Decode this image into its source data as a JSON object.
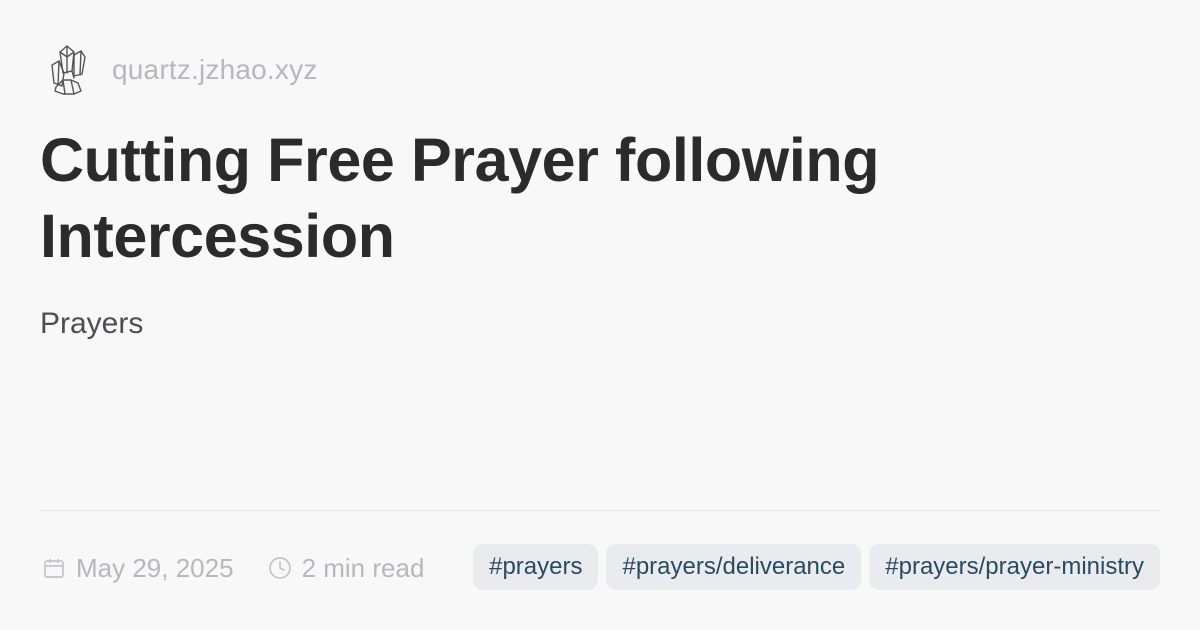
{
  "site": {
    "url": "quartz.jzhao.xyz",
    "logo_icon": "crystal-icon"
  },
  "article": {
    "title": "Cutting Free Prayer following Intercession",
    "description": "Prayers",
    "date": "May 29, 2025",
    "reading_time": "2 min read",
    "tags": [
      "#prayers",
      "#prayers/deliverance",
      "#prayers/prayer-ministry"
    ]
  },
  "icons": {
    "date": "calendar-icon",
    "reading_time": "clock-icon"
  },
  "colors": {
    "background": "#f8f8f9",
    "title": "#2b2b2b",
    "muted_text": "#b8b8bc",
    "tag_background": "#e9ebef",
    "tag_text": "#284b63"
  }
}
